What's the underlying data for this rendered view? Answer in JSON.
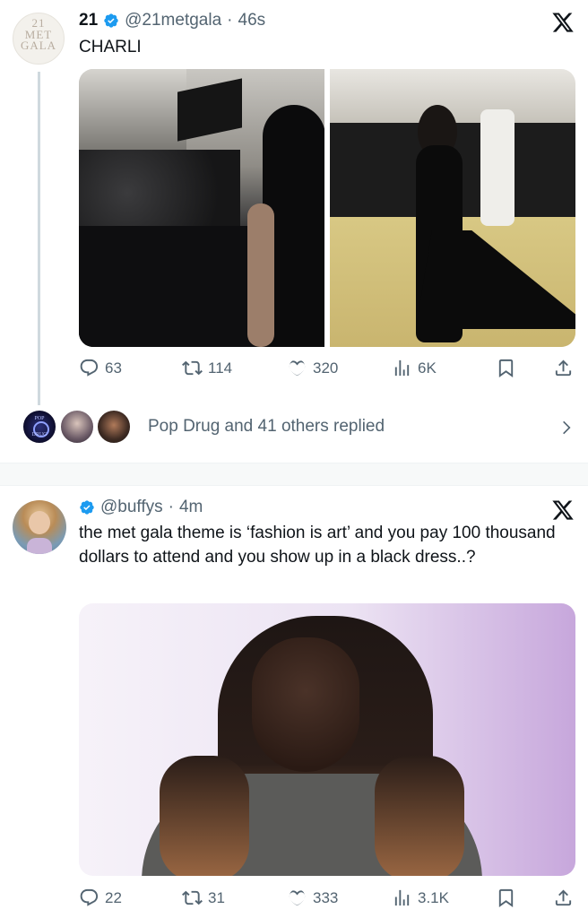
{
  "tweet1": {
    "avatar_text": [
      "21",
      "MET",
      "GALA"
    ],
    "name": "21",
    "handle": "@21metgala",
    "sep": "·",
    "time": "46s",
    "text": "CHARLI",
    "stats": {
      "replies": "63",
      "retweets": "114",
      "likes": "320",
      "views": "6K"
    },
    "replied_text": "Pop Drug and 41 others replied",
    "replied_avatar_text": [
      "POP",
      "DRUG"
    ]
  },
  "tweet2": {
    "handle": "@buffys",
    "sep": "·",
    "time": "4m",
    "text": "the met gala theme is ‘fashion is art’ and you pay 100 thousand dollars to attend and you show up in a black dress..?",
    "stats": {
      "replies": "22",
      "retweets": "31",
      "likes": "333",
      "views": "3.1K"
    }
  },
  "colors": {
    "verified": "#1d9bf0",
    "icon": "#536471",
    "text": "#0f1419",
    "divider": "#eff3f4"
  }
}
